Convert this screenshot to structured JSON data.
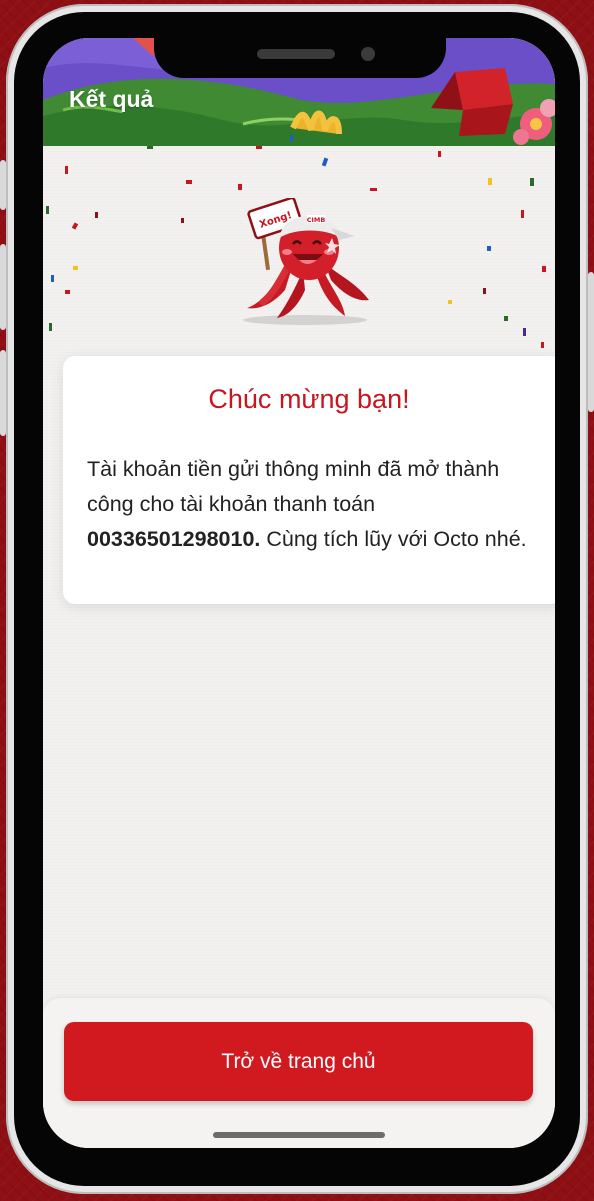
{
  "header": {
    "title": "Kết quả"
  },
  "card": {
    "title": "Chúc mừng bạn!",
    "message_start": "Tài khoản tiền gửi thông minh đã mở thành công cho tài khoản thanh toán ",
    "account_number": "00336501298010.",
    "message_end": " Cùng tích lũy với Octo nhé."
  },
  "mascot": {
    "sign_text": "Xong!",
    "cap_logo": "CIMB"
  },
  "actions": {
    "home_button_label": "Trở về trang chủ"
  },
  "colors": {
    "brand_red": "#d11a20",
    "title_red": "#c8161e",
    "background_red": "#8e0f14",
    "header_purple": "#6a4fc8",
    "header_green": "#3f8a33"
  },
  "icons": [
    "confetti",
    "octopus-mascot",
    "gift-box-icon",
    "flower-icon"
  ]
}
